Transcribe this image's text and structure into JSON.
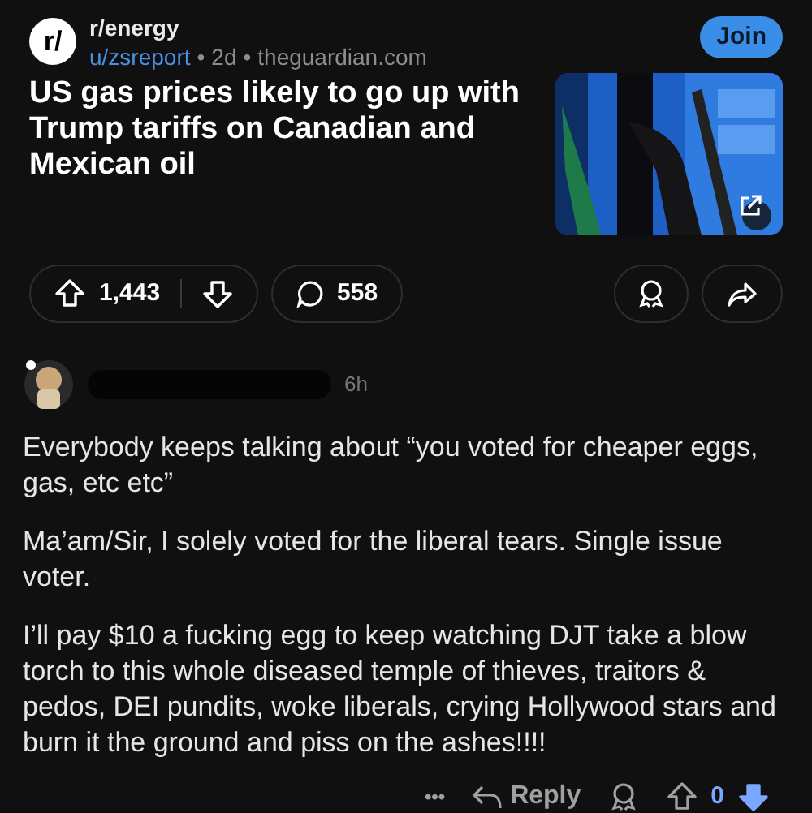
{
  "post": {
    "subreddit": "r/energy",
    "avatar_text": "r/",
    "author": "u/zsreport",
    "separator": "•",
    "age": "2d",
    "domain": "theguardian.com",
    "join_label": "Join",
    "title": "US gas prices likely to go up with Trump tariffs on Canadian and Mexican oil",
    "score": "1,443",
    "upvoted": false,
    "downvoted": false,
    "comments": "558"
  },
  "comment": {
    "age": "6h",
    "paragraphs": [
      "Everybody keeps talking about “you voted for cheaper eggs, gas, etc etc”",
      "Ma’am/Sir, I solely voted for the liberal tears. Single issue voter.",
      "I’ll pay $10 a fucking egg to keep watching DJT take a blow torch to this whole diseased temple of thieves, traitors & pedos, DEI pundits, woke liberals, crying Hollywood stars and burn it the ground and piss on the ashes!!!!"
    ],
    "more": "•••",
    "reply_label": "Reply",
    "score": "0",
    "upvoted": false,
    "downvoted": true
  }
}
